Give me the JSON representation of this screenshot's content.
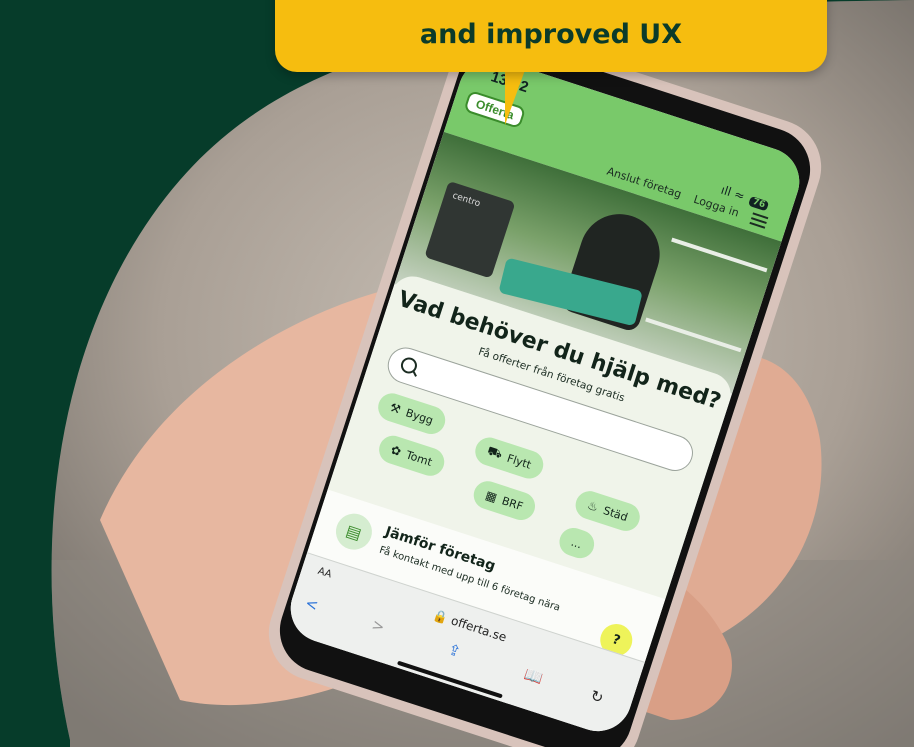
{
  "promo": {
    "headline_line1": "and improved UX"
  },
  "phone": {
    "status": {
      "time": "13:52",
      "signal_label": "ıll",
      "wifi_label": "≈",
      "battery_label": "76"
    },
    "nav": {
      "logo": "Offerta",
      "connect_link": "Anslut företag",
      "login_link": "Logga in"
    },
    "hero": {
      "bucket_label": "centro"
    },
    "search_card": {
      "title": "Vad behöver du hjälp med?",
      "subtitle": "Få offerter från företag gratis",
      "search_placeholder": "",
      "categories": [
        {
          "label": "Bygg",
          "icon": "hammer-icon",
          "glyph": "⚒"
        },
        {
          "label": "Flytt",
          "icon": "truck-icon",
          "glyph": "⛟"
        },
        {
          "label": "Tomt",
          "icon": "mower-icon",
          "glyph": "✿"
        },
        {
          "label": "BRF",
          "icon": "building-icon",
          "glyph": "▦"
        },
        {
          "label": "Städ",
          "icon": "vacuum-icon",
          "glyph": "♨"
        },
        {
          "label": "...",
          "icon": "more-icon",
          "glyph": ""
        }
      ]
    },
    "feature": {
      "title": "Jämför företag",
      "text": "Få kontakt med upp till 6 företag nära",
      "help_label": "?"
    },
    "browser": {
      "text_size_label": "AA",
      "url": "offerta.se",
      "back": "<",
      "forward": ">",
      "share": "⇪",
      "bookmarks": "📖",
      "reload": "↻"
    }
  },
  "colors": {
    "background": "#063c2a",
    "bubble": "#f6bd0f",
    "brand_green": "#79c96a",
    "chip": "#b9e7b0"
  }
}
